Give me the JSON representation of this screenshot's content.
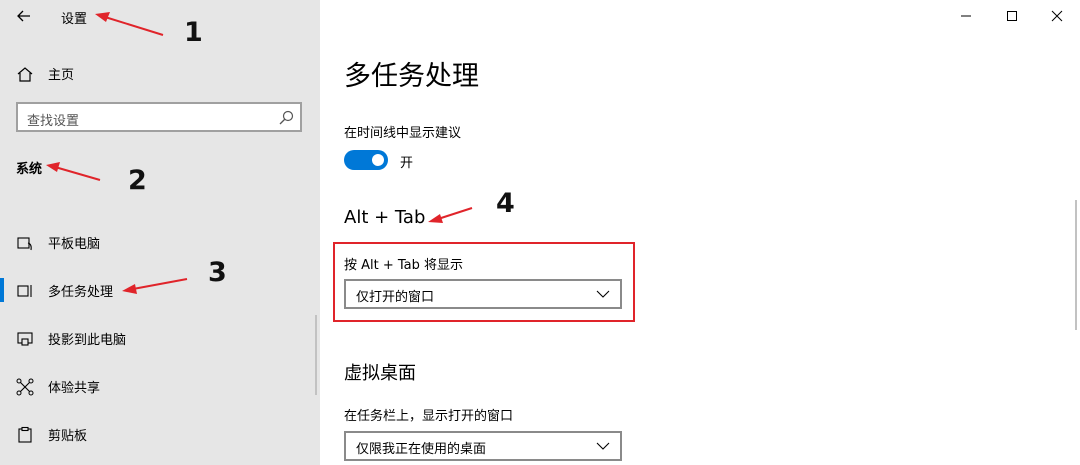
{
  "window": {
    "title": "设置",
    "controls": {
      "minimize": "minimize-icon",
      "maximize": "maximize-icon",
      "close": "close-icon"
    }
  },
  "sidebar": {
    "home_label": "主页",
    "search_placeholder": "查找设置",
    "section_title": "系统",
    "items": [
      {
        "label": "平板电脑",
        "icon": "tablet-icon"
      },
      {
        "label": "多任务处理",
        "icon": "multitasking-icon",
        "selected": true
      },
      {
        "label": "投影到此电脑",
        "icon": "project-icon"
      },
      {
        "label": "体验共享",
        "icon": "share-icon"
      },
      {
        "label": "剪贴板",
        "icon": "clipboard-icon"
      }
    ]
  },
  "main": {
    "page_title": "多任务处理",
    "timeline": {
      "label": "在时间线中显示建议",
      "toggle_state": "开",
      "on": true
    },
    "alt_tab": {
      "heading": "Alt + Tab",
      "field_label": "按 Alt + Tab 将显示",
      "selected": "仅打开的窗口"
    },
    "virtual_desktops": {
      "heading": "虚拟桌面",
      "field_label": "在任务栏上，显示打开的窗口",
      "selected": "仅限我正在使用的桌面"
    }
  },
  "annotations": {
    "one": "1",
    "two": "2",
    "three": "3",
    "four": "4"
  },
  "colors": {
    "accent": "#0078d7",
    "annotation_red": "#e0242a",
    "sidebar_bg": "#e6e6e6"
  }
}
